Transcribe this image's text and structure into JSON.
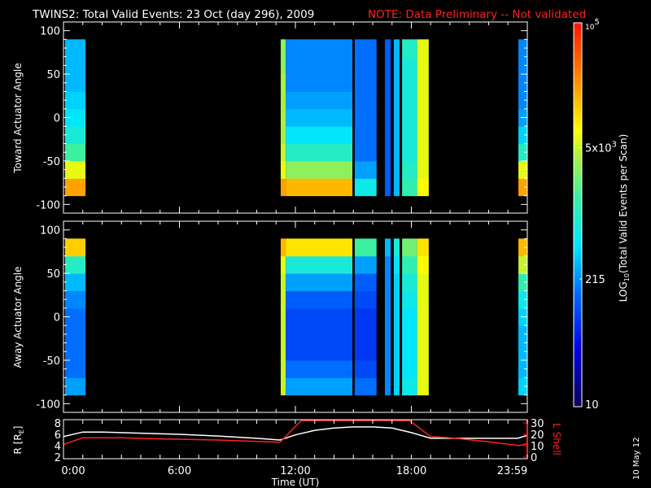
{
  "title": {
    "main": "TWINS2: Total Valid Events: 23 Oct (day 296), 2009",
    "note": "NOTE: Data Preliminary -- Not validated"
  },
  "date_stamp": "10 May 12",
  "colors": {
    "note": "#ff2020",
    "l_shell": "#ff2020",
    "r_curve": "#ffffff",
    "background": "#000000"
  },
  "chart_data": [
    {
      "type": "heatmap",
      "name": "toward",
      "ylabel": "Toward Actuator Angle",
      "ylim": [
        -110,
        110
      ],
      "yticks": [
        "-100",
        "-50",
        "0",
        "50",
        "100"
      ],
      "angle_bins": [
        -80,
        -60,
        -40,
        -20,
        0,
        20,
        40,
        60,
        80
      ],
      "blocks": [
        {
          "t": [
            0.08,
            1.14
          ],
          "log_counts": [
            4.3,
            3.8,
            3.2,
            2.9,
            2.7,
            2.6,
            2.5,
            2.5,
            2.5
          ]
        },
        {
          "t": [
            11.24,
            11.5
          ],
          "log_counts": [
            4.3,
            3.8,
            3.7,
            3.6,
            3.6,
            3.6,
            3.6,
            3.5,
            3.5
          ]
        },
        {
          "t": [
            11.5,
            14.95
          ],
          "log_counts": [
            4.2,
            3.5,
            3.0,
            2.7,
            2.5,
            2.4,
            2.3,
            2.3,
            2.3
          ]
        },
        {
          "t": [
            15.07,
            16.2
          ],
          "log_counts": [
            2.8,
            2.4,
            2.2,
            2.2,
            2.2,
            2.2,
            2.2,
            2.2,
            2.2
          ]
        },
        {
          "t": [
            16.63,
            16.93
          ],
          "log_counts": [
            2.1,
            2.1,
            2.1,
            2.1,
            2.1,
            2.1,
            2.1,
            2.1,
            2.1
          ]
        },
        {
          "t": [
            17.09,
            17.39
          ],
          "log_counts": [
            2.5,
            2.5,
            2.5,
            2.5,
            2.5,
            2.5,
            2.5,
            2.5,
            2.5
          ]
        },
        {
          "t": [
            17.52,
            18.3
          ],
          "log_counts": [
            3.1,
            3.0,
            2.9,
            2.9,
            2.9,
            2.9,
            2.9,
            2.9,
            3.0
          ]
        },
        {
          "t": [
            18.3,
            18.9
          ],
          "log_counts": [
            3.9,
            3.8,
            3.8,
            3.8,
            3.8,
            3.8,
            3.8,
            3.8,
            3.8
          ]
        },
        {
          "t": [
            23.54,
            24.0
          ],
          "log_counts": [
            4.3,
            3.8,
            3.0,
            2.6,
            2.4,
            2.3,
            2.3,
            2.3,
            2.3
          ]
        }
      ]
    },
    {
      "type": "heatmap",
      "name": "away",
      "ylabel": "Away Actuator Angle",
      "ylim": [
        -110,
        110
      ],
      "yticks": [
        "-100",
        "-50",
        "0",
        "50",
        "100"
      ],
      "angle_bins": [
        -80,
        -60,
        -40,
        -20,
        0,
        20,
        40,
        60,
        80
      ],
      "blocks": [
        {
          "t": [
            0.08,
            1.14
          ],
          "log_counts": [
            2.4,
            2.2,
            2.2,
            2.2,
            2.2,
            2.3,
            2.5,
            3.0,
            4.1
          ]
        },
        {
          "t": [
            11.24,
            11.5
          ],
          "log_counts": [
            3.7,
            3.7,
            3.7,
            3.7,
            3.7,
            3.7,
            3.7,
            3.8,
            4.2
          ]
        },
        {
          "t": [
            11.5,
            14.95
          ],
          "log_counts": [
            2.4,
            2.2,
            2.0,
            2.0,
            2.0,
            2.1,
            2.4,
            2.9,
            4.0
          ]
        },
        {
          "t": [
            15.07,
            16.2
          ],
          "log_counts": [
            2.2,
            2.0,
            1.9,
            1.9,
            1.9,
            2.0,
            2.1,
            2.4,
            3.2
          ]
        },
        {
          "t": [
            16.63,
            16.93
          ],
          "log_counts": [
            2.3,
            2.3,
            2.3,
            2.3,
            2.3,
            2.3,
            2.3,
            2.3,
            2.5
          ]
        },
        {
          "t": [
            17.09,
            17.39
          ],
          "log_counts": [
            2.6,
            2.6,
            2.6,
            2.6,
            2.6,
            2.6,
            2.6,
            2.7,
            2.9
          ]
        },
        {
          "t": [
            17.52,
            18.3
          ],
          "log_counts": [
            2.8,
            2.7,
            2.7,
            2.7,
            2.7,
            2.8,
            2.9,
            3.1,
            3.4
          ]
        },
        {
          "t": [
            18.3,
            18.9
          ],
          "log_counts": [
            3.8,
            3.8,
            3.8,
            3.8,
            3.8,
            3.8,
            3.8,
            3.9,
            4.0
          ]
        },
        {
          "t": [
            23.54,
            24.0
          ],
          "log_counts": [
            2.6,
            2.5,
            2.5,
            2.5,
            2.6,
            2.8,
            3.1,
            3.7,
            4.2
          ]
        }
      ]
    },
    {
      "type": "line",
      "name": "orbit",
      "ylabel": "R [R",
      "ylabel_sub": "E",
      "ylabel_close": "]",
      "ylim": [
        2,
        8
      ],
      "yticks": [
        "2",
        "4",
        "6",
        "8"
      ],
      "y2label": "L Shell",
      "y2lim": [
        0,
        30
      ],
      "y2ticks": [
        "0",
        "10",
        "20",
        "30"
      ],
      "xlabel": "Time (UT)",
      "xlim": [
        0,
        24
      ],
      "xticks": [
        {
          "t": 0,
          "label": "0:00"
        },
        {
          "t": 6,
          "label": "6:00"
        },
        {
          "t": 12,
          "label": "12:00"
        },
        {
          "t": 18,
          "label": "18:00"
        },
        {
          "t": 23.98,
          "label": "23:59"
        }
      ],
      "series": [
        {
          "name": "R",
          "axis": "left",
          "x": [
            0,
            1,
            2,
            4,
            6,
            8,
            10,
            11.2,
            12,
            13,
            14,
            15,
            16,
            17,
            18,
            19,
            20,
            22,
            23.5,
            24
          ],
          "y": [
            5.6,
            6.4,
            6.4,
            6.2,
            6.0,
            5.7,
            5.3,
            5.0,
            5.9,
            6.7,
            7.1,
            7.3,
            7.3,
            7.1,
            6.3,
            5.3,
            5.3,
            5.3,
            5.3,
            5.8
          ]
        },
        {
          "name": "L Shell",
          "axis": "right",
          "x": [
            0,
            1,
            3,
            5,
            8,
            11.2,
            12.3,
            17.9,
            19,
            20,
            22,
            23.6,
            24
          ],
          "y": [
            11,
            17,
            17,
            16,
            15,
            13,
            32,
            32,
            18,
            17,
            13.5,
            10,
            12
          ]
        }
      ]
    },
    {
      "type": "colorbar",
      "label_pre": "LOG",
      "label_sub": "10",
      "label_post": "(Total Valid Events per Scan)",
      "range_log": [
        1,
        5
      ],
      "ticks": [
        {
          "log": 1,
          "label": "10"
        },
        {
          "log": 2.33,
          "label": "215"
        },
        {
          "log": 3.7,
          "label": "5x10",
          "sup": "3"
        },
        {
          "log": 5,
          "label": "10",
          "sup": "5"
        }
      ]
    }
  ]
}
